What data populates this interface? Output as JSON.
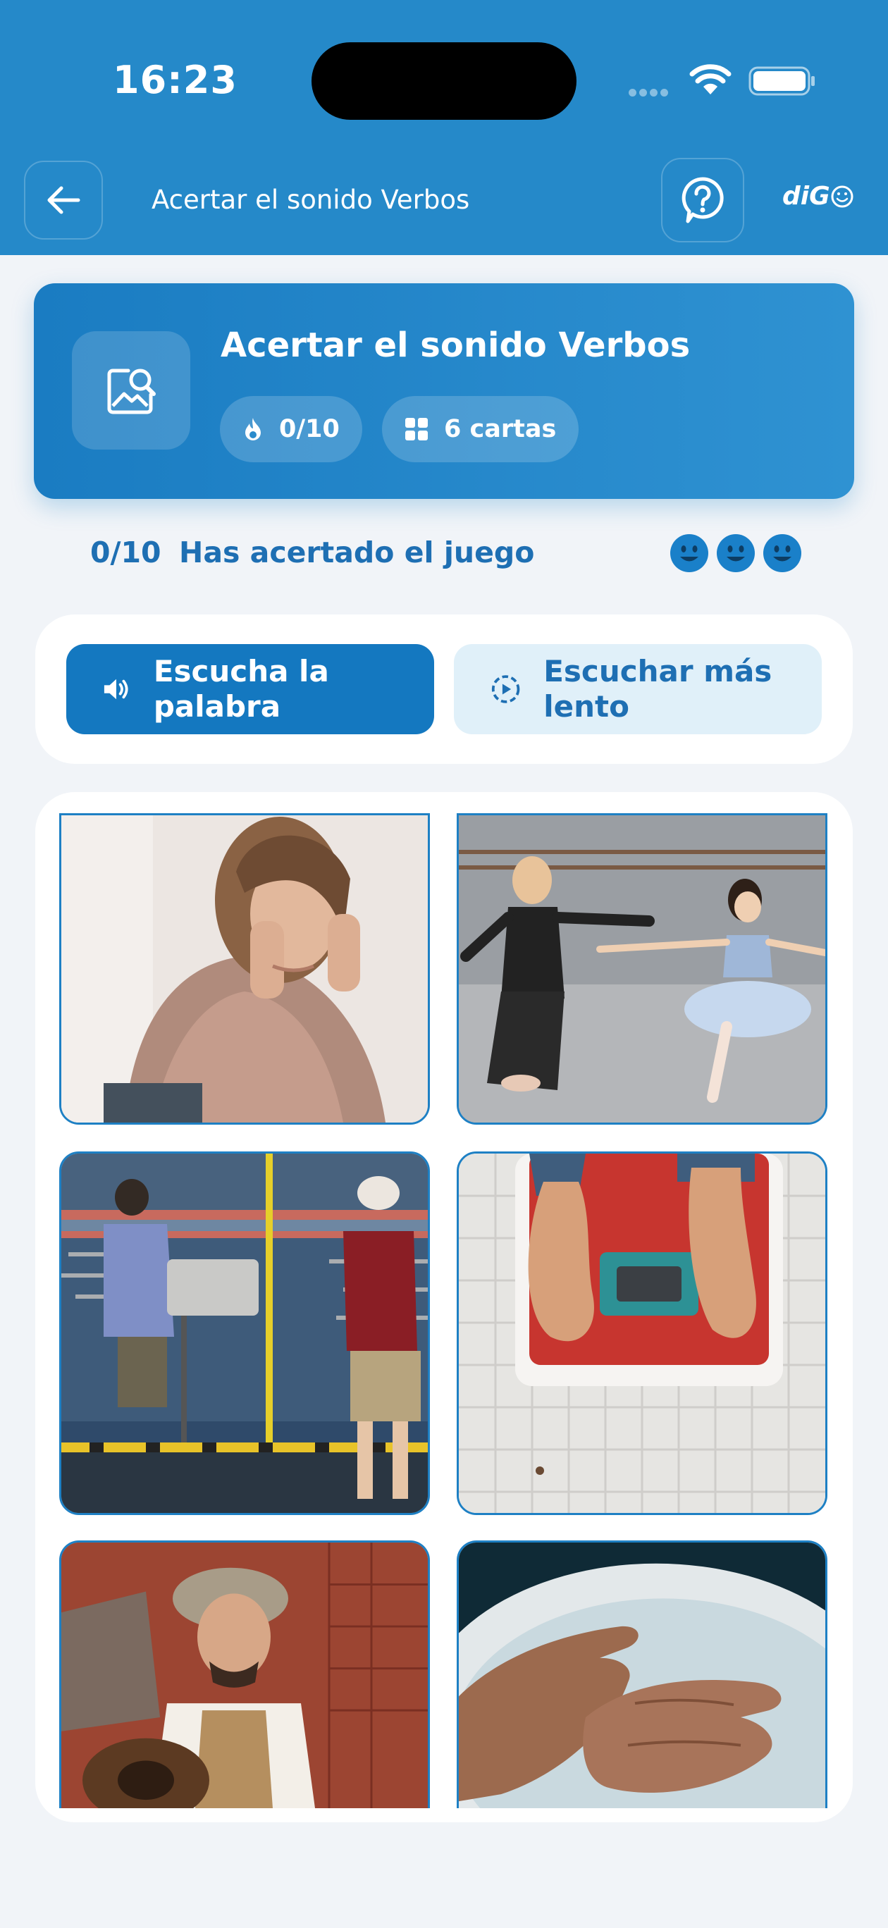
{
  "status_bar": {
    "time": "16:23"
  },
  "header": {
    "title": "Acertar el sonido Verbos",
    "brand": "diG",
    "back_icon": "arrow-left-icon",
    "help_icon": "help-circle-icon",
    "background_color": "#2589c9"
  },
  "game_card": {
    "title": "Acertar el sonido Verbos",
    "icon": "image-search-icon",
    "score_icon": "flame-icon",
    "score": "0/10",
    "cards_icon": "grid-icon",
    "cards_label": "6 cartas"
  },
  "progress": {
    "count": "0/10",
    "label": "Has acertado el juego",
    "lives_icon": "smiley-icon",
    "lives_remaining": 3
  },
  "audio": {
    "listen_label": "Escucha la palabra",
    "listen_icon": "speaker-icon",
    "slow_label": "Escuchar más lento",
    "slow_icon": "slow-play-icon"
  },
  "cards": [
    {
      "image": "woman-holding-head-photo"
    },
    {
      "image": "ballet-dancers-photo"
    },
    {
      "image": "camera-operators-stadium-photo"
    },
    {
      "image": "feet-on-scale-photo"
    },
    {
      "image": "man-playing-guitar-photo"
    },
    {
      "image": "hands-in-water-photo"
    }
  ],
  "colors": {
    "primary": "#1e6fb3",
    "accent": "#2589c9",
    "button_fill": "#1478c0",
    "button_light": "#e0f0f9",
    "card_border": "#1e80c4",
    "page_background": "#f1f4f8"
  }
}
